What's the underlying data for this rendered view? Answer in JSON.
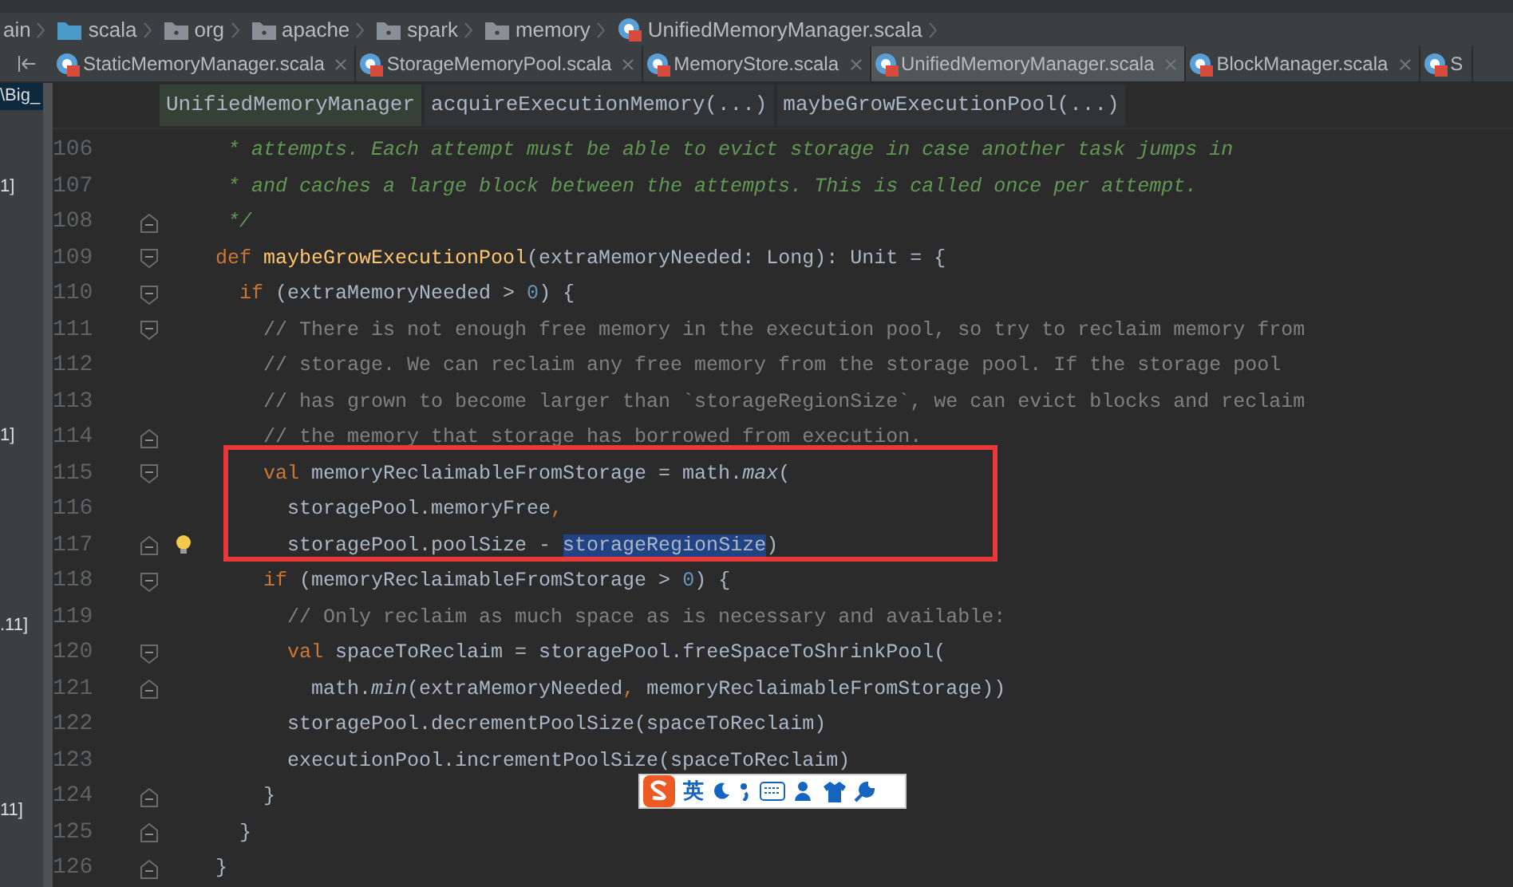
{
  "breadcrumb": [
    {
      "label": "ain",
      "kind": "plain"
    },
    {
      "label": "scala",
      "kind": "source-folder"
    },
    {
      "label": "org",
      "kind": "package"
    },
    {
      "label": "apache",
      "kind": "package"
    },
    {
      "label": "spark",
      "kind": "package"
    },
    {
      "label": "memory",
      "kind": "package"
    },
    {
      "label": "UnifiedMemoryManager.scala",
      "kind": "file"
    }
  ],
  "tabs": [
    {
      "label": "StaticMemoryManager.scala",
      "selected": false,
      "closable": true
    },
    {
      "label": "StorageMemoryPool.scala",
      "selected": false,
      "closable": true
    },
    {
      "label": "MemoryStore.scala",
      "selected": false,
      "closable": true
    },
    {
      "label": "UnifiedMemoryManager.scala",
      "selected": true,
      "closable": true
    },
    {
      "label": "BlockManager.scala",
      "selected": false,
      "closable": true
    },
    {
      "label": "S",
      "selected": false,
      "closable": false
    }
  ],
  "side_panel": [
    {
      "text": "\\Big_",
      "selected": true
    },
    {
      "text": "1]",
      "selected": false
    },
    {
      "text": "1]",
      "selected": false
    },
    {
      "text": ".11]",
      "selected": false
    },
    {
      "text": "11]",
      "selected": false
    }
  ],
  "structure_path": [
    {
      "label": "UnifiedMemoryManager",
      "selected": true
    },
    {
      "label": "acquireExecutionMemory(...)",
      "selected": false
    },
    {
      "label": "maybeGrowExecutionPool(...)",
      "selected": false
    }
  ],
  "code_lines": [
    {
      "number": "106",
      "kind": "plain",
      "segments": [
        {
          "kind": "doc",
          "text": "     * attempts. Each attempt must be able to evict storage in case another task jumps in"
        }
      ]
    },
    {
      "number": "107",
      "kind": "plain",
      "segments": [
        {
          "kind": "doc",
          "text": "     * and caches a large block between the attempts. This is called once per attempt."
        }
      ]
    },
    {
      "number": "108",
      "kind": "fold-end",
      "segments": [
        {
          "kind": "doc",
          "text": "     */"
        }
      ]
    },
    {
      "number": "109",
      "kind": "fold-start",
      "segments": [
        {
          "kind": "keyword",
          "text": "    def "
        },
        {
          "kind": "method",
          "text": "maybeGrowExecutionPool"
        },
        {
          "kind": "plain",
          "text": "(extraMemoryNeeded: Long): Unit = {"
        }
      ]
    },
    {
      "number": "110",
      "kind": "fold-start",
      "segments": [
        {
          "kind": "keyword",
          "text": "      if "
        },
        {
          "kind": "plain",
          "text": "(extraMemoryNeeded > "
        },
        {
          "kind": "number",
          "text": "0"
        },
        {
          "kind": "plain",
          "text": ") {"
        }
      ]
    },
    {
      "number": "111",
      "kind": "fold-start",
      "segments": [
        {
          "kind": "comment",
          "text": "        // There is not enough free memory in the execution pool, so try to reclaim memory from"
        }
      ]
    },
    {
      "number": "112",
      "kind": "plain",
      "segments": [
        {
          "kind": "comment",
          "text": "        // storage. We can reclaim any free memory from the storage pool. If the storage pool"
        }
      ]
    },
    {
      "number": "113",
      "kind": "plain",
      "segments": [
        {
          "kind": "comment",
          "text": "        // has grown to become larger than `storageRegionSize`, we can evict blocks and reclaim"
        }
      ]
    },
    {
      "number": "114",
      "kind": "fold-end",
      "segments": [
        {
          "kind": "comment",
          "text": "        // the memory that storage has borrowed from execution."
        }
      ]
    },
    {
      "number": "115",
      "kind": "fold-start",
      "segments": [
        {
          "kind": "keyword",
          "text": "        val "
        },
        {
          "kind": "plain",
          "text": "memoryReclaimableFromStorage = math."
        },
        {
          "kind": "italic",
          "text": "max"
        },
        {
          "kind": "plain",
          "text": "("
        }
      ]
    },
    {
      "number": "116",
      "kind": "plain",
      "segments": [
        {
          "kind": "plain",
          "text": "          storagePool.memoryFree"
        },
        {
          "kind": "keyword",
          "text": ","
        }
      ]
    },
    {
      "number": "117",
      "kind": "fold-end",
      "bulb": true,
      "segments": [
        {
          "kind": "plain",
          "text": "          storagePool.poolSize - "
        },
        {
          "kind": "selected",
          "text": "storageRegionSize"
        },
        {
          "kind": "plain",
          "text": ")"
        }
      ]
    },
    {
      "number": "118",
      "kind": "fold-start",
      "segments": [
        {
          "kind": "keyword",
          "text": "        if "
        },
        {
          "kind": "plain",
          "text": "(memoryReclaimableFromStorage > "
        },
        {
          "kind": "number",
          "text": "0"
        },
        {
          "kind": "plain",
          "text": ") {"
        }
      ]
    },
    {
      "number": "119",
      "kind": "plain",
      "segments": [
        {
          "kind": "comment",
          "text": "          // Only reclaim as much space as is necessary and available:"
        }
      ]
    },
    {
      "number": "120",
      "kind": "fold-start",
      "segments": [
        {
          "kind": "keyword",
          "text": "          val "
        },
        {
          "kind": "plain",
          "text": "spaceToReclaim = storagePool.freeSpaceToShrinkPool("
        }
      ]
    },
    {
      "number": "121",
      "kind": "fold-end",
      "segments": [
        {
          "kind": "plain",
          "text": "            math."
        },
        {
          "kind": "italic",
          "text": "min"
        },
        {
          "kind": "plain",
          "text": "(extraMemoryNeeded"
        },
        {
          "kind": "keyword",
          "text": ", "
        },
        {
          "kind": "plain",
          "text": "memoryReclaimableFromStorage))"
        }
      ]
    },
    {
      "number": "122",
      "kind": "plain",
      "segments": [
        {
          "kind": "plain",
          "text": "          storagePool.decrementPoolSize(spaceToReclaim)"
        }
      ]
    },
    {
      "number": "123",
      "kind": "plain",
      "segments": [
        {
          "kind": "plain",
          "text": "          executionPool.incrementPoolSize(spaceToReclaim)"
        }
      ]
    },
    {
      "number": "124",
      "kind": "fold-end",
      "segments": [
        {
          "kind": "plain",
          "text": "        }"
        }
      ]
    },
    {
      "number": "125",
      "kind": "fold-end",
      "segments": [
        {
          "kind": "plain",
          "text": "      }"
        }
      ]
    },
    {
      "number": "126",
      "kind": "fold-end",
      "segments": [
        {
          "kind": "plain",
          "text": "    }"
        }
      ]
    }
  ],
  "ime_toolbar": {
    "mode": "英"
  }
}
